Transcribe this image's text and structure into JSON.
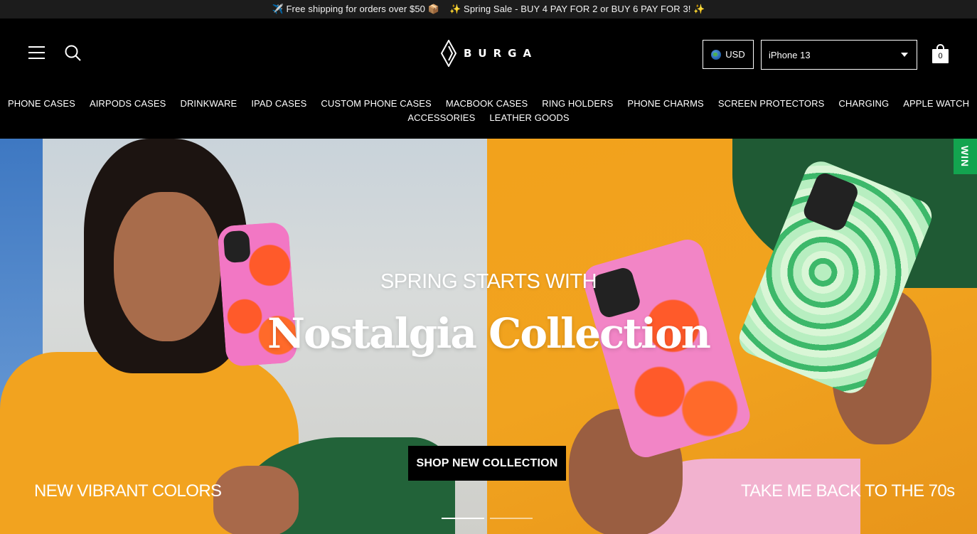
{
  "announcement": {
    "left_emoji": "✈️",
    "shipping_text": "Free shipping for orders over $50",
    "box_emoji": "📦",
    "sparkle": "✨",
    "sale_text": "Spring Sale - BUY 4 PAY FOR 2 or BUY 6 PAY FOR 3!"
  },
  "header": {
    "menu_icon": "hamburger-menu-icon",
    "search_icon": "search-icon",
    "logo_text": "BURGA",
    "currency_label": "USD",
    "device_selected": "iPhone 13",
    "cart_count": "0"
  },
  "nav": {
    "row1": [
      "PHONE CASES",
      "AIRPODS CASES",
      "DRINKWARE",
      "IPAD CASES",
      "CUSTOM PHONE CASES",
      "MACBOOK CASES",
      "RING HOLDERS",
      "PHONE CHARMS",
      "SCREEN PROTECTORS",
      "CHARGING",
      "APPLE WATCH"
    ],
    "row2": [
      "ACCESSORIES",
      "LEATHER GOODS"
    ]
  },
  "hero": {
    "headline_small": "SPRING STARTS WITH",
    "headline_big": "Nostalgia Collection",
    "cta_label": "SHOP NEW COLLECTION",
    "caption_left": "NEW VIBRANT COLORS",
    "caption_right": "TAKE ME BACK TO THE 70s",
    "slide_count": 2,
    "active_slide": 1,
    "side_tab": "WIN"
  },
  "colors": {
    "announcement_bg": "#1c1c1c",
    "header_bg": "#000000",
    "cta_bg": "#000000",
    "side_tab_bg": "#13a44f"
  }
}
